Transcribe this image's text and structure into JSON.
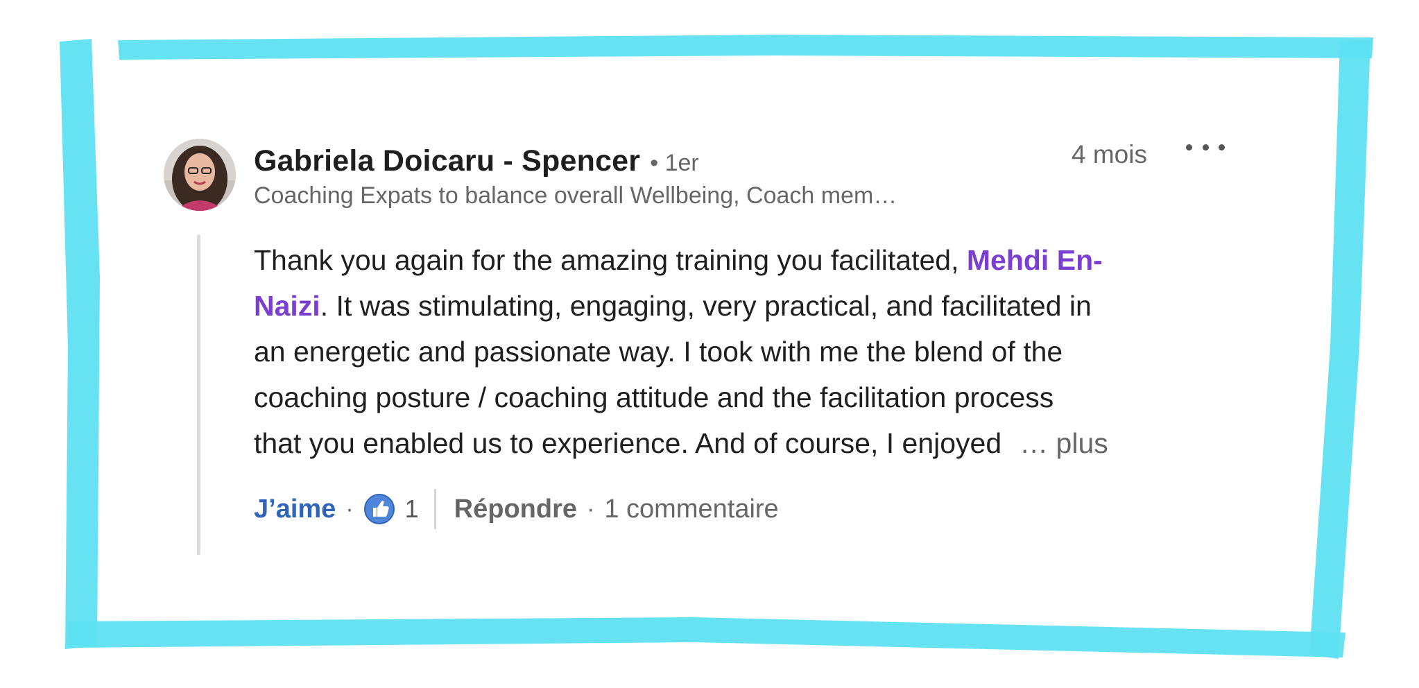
{
  "comment": {
    "author": {
      "name": "Gabriela Doicaru - Spencer",
      "connection": "• 1er",
      "headline": "Coaching Expats to balance overall Wellbeing, Coach mem…"
    },
    "timestamp": "4 mois",
    "body": {
      "line1_before": "Thank you again for the amazing training you facilitated, ",
      "mention_part1": "Mehdi En-",
      "mention_part2": "Naizi",
      "line2_after": ". It was stimulating, engaging, very practical, and facilitated in",
      "line3": "an energetic and passionate way. I took with me the blend of the",
      "line4": "coaching posture / coaching attitude and the facilitation process",
      "line5": "that you enabled us to experience. And of course, I enjoyed",
      "see_more": "… plus"
    },
    "actions": {
      "like_label": "J’aime",
      "dot": "·",
      "like_count": "1",
      "reply_label": "Répondre",
      "comment_count": "1 commentaire"
    }
  },
  "colors": {
    "frame": "#5ee0f2",
    "mention": "#7a3fd1",
    "like": "#2f64b8",
    "secondary_text": "#666666"
  }
}
